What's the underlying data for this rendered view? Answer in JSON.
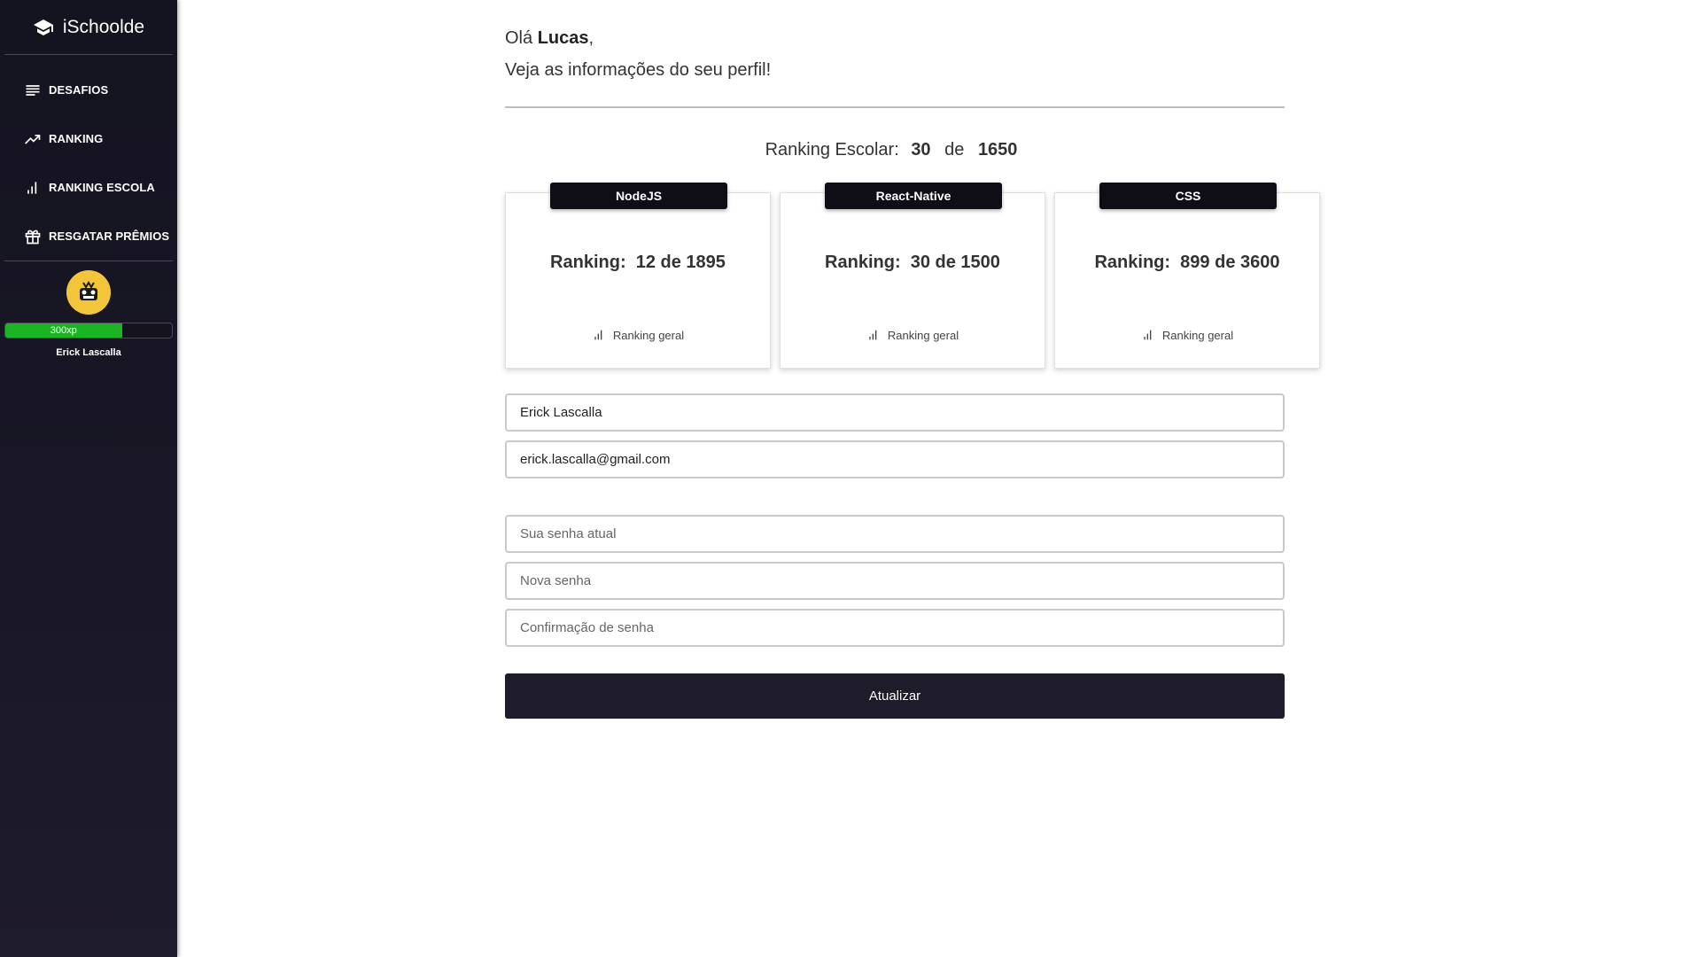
{
  "sidebar": {
    "brand": "iSchoolde",
    "items": [
      {
        "label": "DESAFIOS",
        "icon": "list-icon"
      },
      {
        "label": "RANKING",
        "icon": "trending-up-icon"
      },
      {
        "label": "RANKING ESCOLA",
        "icon": "bar-chart-icon"
      },
      {
        "label": "RESGATAR PRÊMIOS",
        "icon": "gift-icon"
      }
    ],
    "profile": {
      "xp_label": "300xp",
      "xp_progress": 0.7,
      "name": "Erick Lascalla"
    }
  },
  "greeting": {
    "hello": "Olá",
    "name": "Lucas",
    "comma": ",",
    "subtitle": "Veja as informações do seu perfil!"
  },
  "school_ranking": {
    "label": "Ranking Escolar:",
    "position": "30",
    "de": "de",
    "total": "1650"
  },
  "cards": [
    {
      "tag": "NodeJS",
      "rank_label": "Ranking:",
      "rank_value": "12 de 1895",
      "footer": "Ranking geral"
    },
    {
      "tag": "React-Native",
      "rank_label": "Ranking:",
      "rank_value": "30 de 1500",
      "footer": "Ranking geral"
    },
    {
      "tag": "CSS",
      "rank_label": "Ranking:",
      "rank_value": "899 de 3600",
      "footer": "Ranking geral"
    }
  ],
  "form": {
    "name_value": "Erick Lascalla",
    "email_value": "erick.lascalla@gmail.com",
    "current_password_placeholder": "Sua senha atual",
    "new_password_placeholder": "Nova senha",
    "confirm_password_placeholder": "Confirmação de senha",
    "submit_label": "Atualizar"
  },
  "colors": {
    "sidebar_bg": "#1e1b2a",
    "xp_fill": "#1bb523",
    "tag_bg": "#0f0e17"
  }
}
